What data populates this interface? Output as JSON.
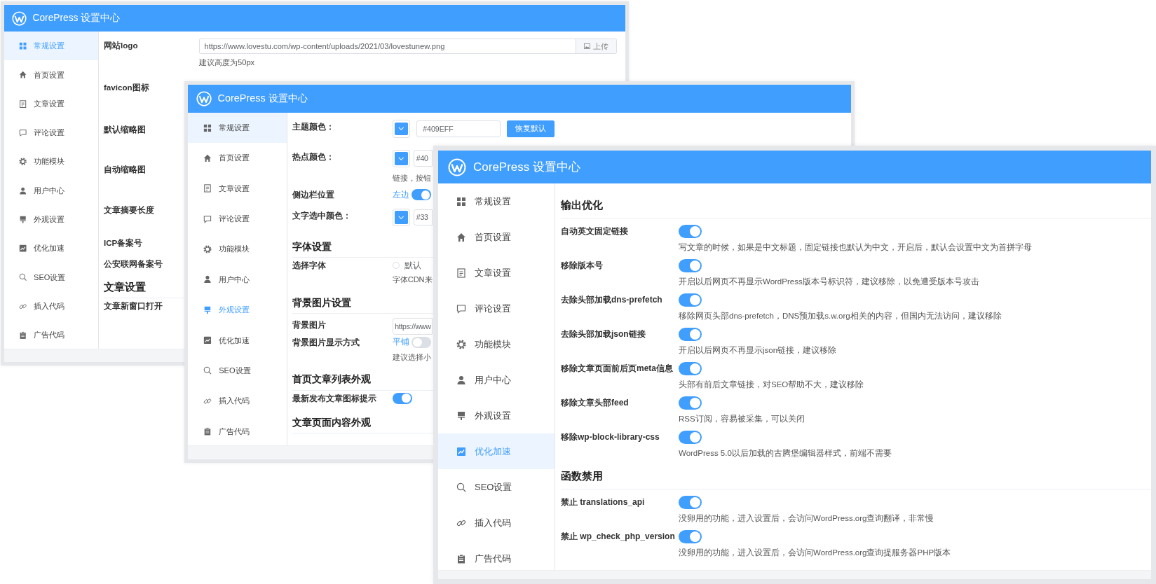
{
  "windows": [
    {
      "title": "CorePress 设置中心",
      "sidebar": [
        {
          "label": "常规设置",
          "selected": true,
          "highlighted": true
        },
        {
          "label": "首页设置",
          "selected": false,
          "highlighted": false
        },
        {
          "label": "文章设置",
          "selected": false,
          "highlighted": false
        },
        {
          "label": "评论设置",
          "selected": false,
          "highlighted": false
        },
        {
          "label": "功能模块",
          "selected": false,
          "highlighted": false
        },
        {
          "label": "用户中心",
          "selected": false,
          "highlighted": false
        },
        {
          "label": "外观设置",
          "selected": false,
          "highlighted": false
        },
        {
          "label": "优化加速",
          "selected": false,
          "highlighted": false
        },
        {
          "label": "SEO设置",
          "selected": false,
          "highlighted": false
        },
        {
          "label": "插入代码",
          "selected": false,
          "highlighted": false
        },
        {
          "label": "广告代码",
          "selected": false,
          "highlighted": false
        }
      ],
      "rows": [
        {
          "kind": "upload",
          "label": "网站logo",
          "value": "https://www.lovestu.com/wp-content/uploads/2021/03/lovestunew.png",
          "button": "上传",
          "hint": "建议高度为50px"
        },
        {
          "kind": "label",
          "label": "favicon图标"
        },
        {
          "kind": "label",
          "label": "默认缩略图"
        },
        {
          "kind": "label",
          "label": "自动缩略图"
        },
        {
          "kind": "label",
          "label": "文章摘要长度"
        },
        {
          "kind": "label",
          "label": "ICP备案号"
        },
        {
          "kind": "label",
          "label": "公安联网备案号"
        },
        {
          "kind": "heading",
          "label": "文章设置"
        },
        {
          "kind": "label",
          "label": "文章新窗口打开"
        }
      ]
    },
    {
      "title": "CorePress 设置中心",
      "sidebar": [
        {
          "label": "常规设置",
          "selected": false,
          "highlighted": true
        },
        {
          "label": "首页设置",
          "selected": false,
          "highlighted": false
        },
        {
          "label": "文章设置",
          "selected": false,
          "highlighted": false
        },
        {
          "label": "评论设置",
          "selected": false,
          "highlighted": false
        },
        {
          "label": "功能模块",
          "selected": false,
          "highlighted": false
        },
        {
          "label": "用户中心",
          "selected": false,
          "highlighted": false
        },
        {
          "label": "外观设置",
          "selected": true,
          "highlighted": false
        },
        {
          "label": "优化加速",
          "selected": false,
          "highlighted": false
        },
        {
          "label": "SEO设置",
          "selected": false,
          "highlighted": false
        },
        {
          "label": "插入代码",
          "selected": false,
          "highlighted": false
        },
        {
          "label": "广告代码",
          "selected": false,
          "highlighted": false
        }
      ],
      "rows": [
        {
          "kind": "color",
          "label": "主题颜色：",
          "value": "#409EFF",
          "button": "恢复默认"
        },
        {
          "kind": "color",
          "label": "热点颜色：",
          "value": "#40"
        },
        {
          "kind": "hint",
          "hint": "链接，按钮"
        },
        {
          "kind": "toggle",
          "label": "侧边栏位置",
          "prefix": "左边",
          "on": true
        },
        {
          "kind": "color",
          "label": "文字选中颜色：",
          "value": "#33"
        },
        {
          "kind": "heading",
          "label": "字体设置"
        },
        {
          "kind": "radio",
          "label": "选择字体",
          "option": "默认",
          "checked": false
        },
        {
          "kind": "hint",
          "hint": "字体CDN来"
        },
        {
          "kind": "heading",
          "label": "背景图片设置"
        },
        {
          "kind": "input",
          "label": "背景图片",
          "value": "https://www"
        },
        {
          "kind": "toggle",
          "label": "背景图片显示方式",
          "prefix": "平铺",
          "on": false
        },
        {
          "kind": "hint",
          "hint": "建议选择小"
        },
        {
          "kind": "heading",
          "label": "首页文章列表外观"
        },
        {
          "kind": "toggle",
          "label": "最新发布文章图标提示",
          "on": true
        },
        {
          "kind": "heading",
          "label": "文章页面内容外观"
        }
      ]
    },
    {
      "title": "CorePress 设置中心",
      "sidebar": [
        {
          "label": "常规设置",
          "selected": false,
          "highlighted": false
        },
        {
          "label": "首页设置",
          "selected": false,
          "highlighted": false
        },
        {
          "label": "文章设置",
          "selected": false,
          "highlighted": false
        },
        {
          "label": "评论设置",
          "selected": false,
          "highlighted": false
        },
        {
          "label": "功能模块",
          "selected": false,
          "highlighted": false
        },
        {
          "label": "用户中心",
          "selected": false,
          "highlighted": false
        },
        {
          "label": "外观设置",
          "selected": false,
          "highlighted": false
        },
        {
          "label": "优化加速",
          "selected": true,
          "highlighted": true
        },
        {
          "label": "SEO设置",
          "selected": false,
          "highlighted": false
        },
        {
          "label": "插入代码",
          "selected": false,
          "highlighted": false
        },
        {
          "label": "广告代码",
          "selected": false,
          "highlighted": false
        }
      ],
      "rows": [
        {
          "kind": "heading",
          "label": "输出优化"
        },
        {
          "kind": "toggle",
          "label": "自动英文固定链接",
          "on": true,
          "description": "写文章的时候，如果是中文标题，固定链接也默认为中文，开启后，默认会设置中文为首拼字母"
        },
        {
          "kind": "toggle",
          "label": "移除版本号",
          "on": true,
          "description": "开启以后网页不再显示WordPress版本号标识符，建议移除，以免遭受版本号攻击"
        },
        {
          "kind": "toggle",
          "label": "去除头部加载dns-prefetch",
          "on": true,
          "description": "移除网页头部dns-prefetch，DNS预加载s.w.org相关的内容，但国内无法访问，建议移除"
        },
        {
          "kind": "toggle",
          "label": "去除头部加载json链接",
          "on": true,
          "description": "开启以后网页不再显示json链接，建议移除"
        },
        {
          "kind": "toggle",
          "label": "移除文章页面前后页meta信息",
          "on": true,
          "description": "头部有前后文章链接，对SEO帮助不大，建议移除"
        },
        {
          "kind": "toggle",
          "label": "移除文章头部feed",
          "on": true,
          "description": "RSS订阅，容易被采集，可以关闭"
        },
        {
          "kind": "toggle",
          "label": "移除wp-block-library-css",
          "on": true,
          "description": "WordPress 5.0以后加载的古腾堡编辑器样式，前端不需要"
        },
        {
          "kind": "heading",
          "label": "函数禁用"
        },
        {
          "kind": "toggle",
          "label": "禁止 translations_api",
          "on": true,
          "description": "没卵用的功能，进入设置后，会访问WordPress.org查询翻译，非常慢"
        },
        {
          "kind": "toggle",
          "label": "禁止 wp_check_php_version",
          "on": true,
          "description": "没卵用的功能，进入设置后，会访问WordPress.org查询提服务器PHP版本"
        }
      ]
    }
  ]
}
